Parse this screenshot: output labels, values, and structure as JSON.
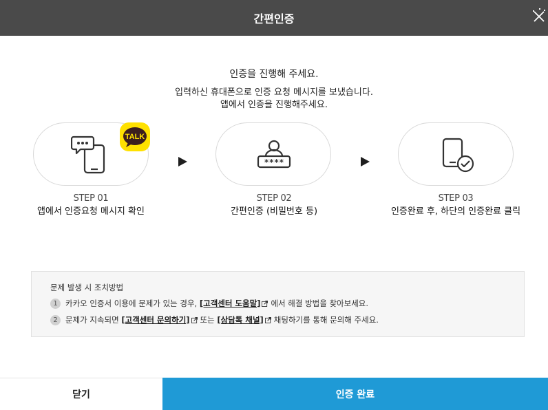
{
  "header": {
    "title": "간편인증",
    "close_icon": "close-icon"
  },
  "intro": {
    "line1": "인증을 진행해 주세요.",
    "line2": "입력하신 휴대폰으로 인증 요청 메시지를 보냈습니다.",
    "line3": "앱에서 인증을 진행해주세요."
  },
  "steps": [
    {
      "num": "STEP 01",
      "desc": "앱에서 인증요청 메시지 확인",
      "icon": "phone-message-icon",
      "badge": "TALK"
    },
    {
      "num": "STEP 02",
      "desc": "간편인증 (비밀번호 등)",
      "icon": "password-user-icon",
      "masked": "****"
    },
    {
      "num": "STEP 03",
      "desc": "인증완료 후, 하단의 인증완료 클릭",
      "icon": "phone-check-icon"
    }
  ],
  "notice": {
    "title": "문제 발생 시 조치방법",
    "item1": {
      "num": "1",
      "text_before": "카카오 인증서 이용에 문제가 있는 경우,",
      "link": "[고객센터 도움말]",
      "text_after": "에서 해결 방법을 찾아보세요."
    },
    "item2": {
      "num": "2",
      "text_before": "문제가 지속되면",
      "link1": "[고객센터 문의하기]",
      "middle": "또는",
      "link2": "[상담톡 채널]",
      "text_after": "채팅하기를 통해 문의해 주세요."
    }
  },
  "footer": {
    "close_label": "닫기",
    "confirm_label": "인증 완료"
  },
  "colors": {
    "header_bg": "#4a4a4a",
    "confirm_bg": "#1f9ad6",
    "talk_yellow": "#ffe100"
  }
}
